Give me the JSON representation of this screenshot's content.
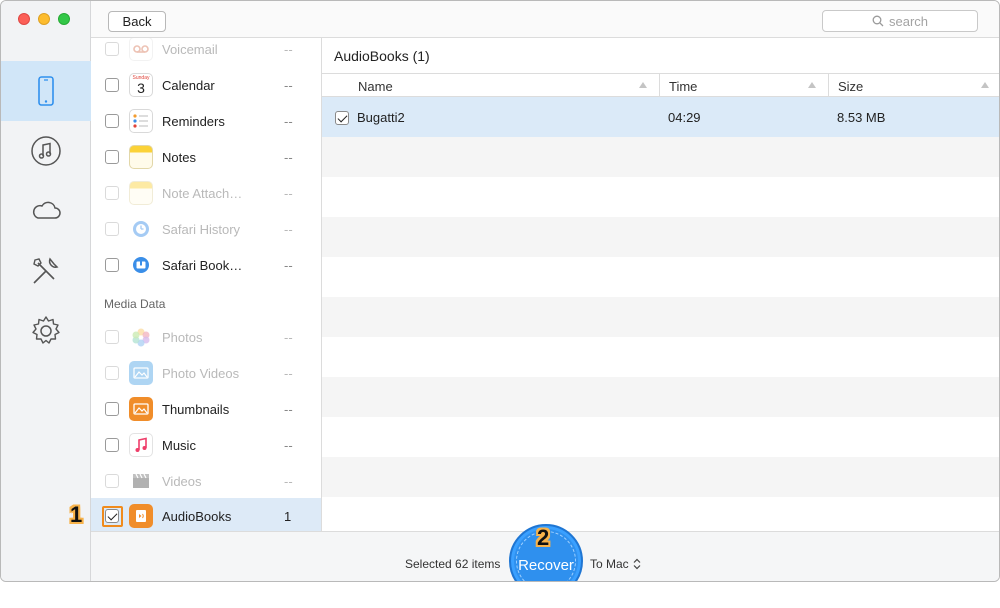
{
  "toolbar": {
    "back_label": "Back",
    "search_placeholder": "search"
  },
  "rail": {
    "items": [
      {
        "name": "device",
        "icon": "phone-icon",
        "active": true
      },
      {
        "name": "itunes",
        "icon": "music-note-icon",
        "active": false
      },
      {
        "name": "icloud",
        "icon": "cloud-icon",
        "active": false
      },
      {
        "name": "tools",
        "icon": "tools-icon",
        "active": false
      },
      {
        "name": "settings",
        "icon": "gear-icon",
        "active": false
      }
    ]
  },
  "categories": {
    "section_media": "Media Data",
    "items": [
      {
        "label": "Voicemail",
        "count": "--",
        "enabled": false,
        "icon": "voicemail-icon"
      },
      {
        "label": "Calendar",
        "count": "--",
        "enabled": true,
        "icon": "calendar-icon",
        "icon_text": "3",
        "icon_sub": "Sunday"
      },
      {
        "label": "Reminders",
        "count": "--",
        "enabled": true,
        "icon": "reminders-icon"
      },
      {
        "label": "Notes",
        "count": "--",
        "enabled": true,
        "icon": "notes-icon"
      },
      {
        "label": "Note Attach…",
        "count": "--",
        "enabled": false,
        "icon": "note-attachment-icon"
      },
      {
        "label": "Safari History",
        "count": "--",
        "enabled": false,
        "icon": "safari-history-icon"
      },
      {
        "label": "Safari Book…",
        "count": "--",
        "enabled": true,
        "icon": "safari-bookmark-icon"
      },
      {
        "label": "Photos",
        "count": "--",
        "enabled": false,
        "icon": "photos-icon"
      },
      {
        "label": "Photo Videos",
        "count": "--",
        "enabled": false,
        "icon": "photo-videos-icon"
      },
      {
        "label": "Thumbnails",
        "count": "--",
        "enabled": true,
        "icon": "thumbnails-icon"
      },
      {
        "label": "Music",
        "count": "--",
        "enabled": true,
        "icon": "music-icon"
      },
      {
        "label": "Videos",
        "count": "--",
        "enabled": false,
        "icon": "videos-icon"
      },
      {
        "label": "AudioBooks",
        "count": "1",
        "enabled": true,
        "icon": "audiobooks-icon",
        "checked": true,
        "selected": true
      }
    ]
  },
  "main": {
    "title": "AudioBooks (1)",
    "columns": [
      "Name",
      "Time",
      "Size"
    ],
    "rows": [
      {
        "name": "Bugatti2",
        "time": "04:29",
        "size": "8.53 MB",
        "checked": true
      }
    ]
  },
  "footer": {
    "selected_text": "Selected 62 items",
    "recover_label": "Recover",
    "destination": "To Mac"
  },
  "annotations": {
    "step1": "1",
    "step2": "2"
  },
  "colors": {
    "accent": "#2f90ee",
    "selection": "#ddeaf7",
    "annotation": "#f08b1c"
  }
}
